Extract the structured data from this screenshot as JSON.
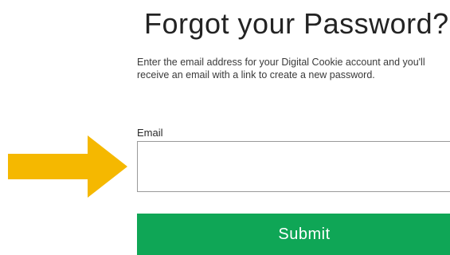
{
  "page": {
    "title": "Forgot your Password?",
    "instructions": "Enter the email address for your Digital Cookie account and you'll receive an email with a link to create a new password."
  },
  "form": {
    "email_label": "Email",
    "email_value": "",
    "email_placeholder": "",
    "submit_label": "Submit"
  },
  "colors": {
    "submit_background": "#0fa656",
    "arrow": "#f5b800",
    "input_border": "#9a9a9a"
  },
  "icons": {
    "pointer": "arrow-right-icon"
  }
}
